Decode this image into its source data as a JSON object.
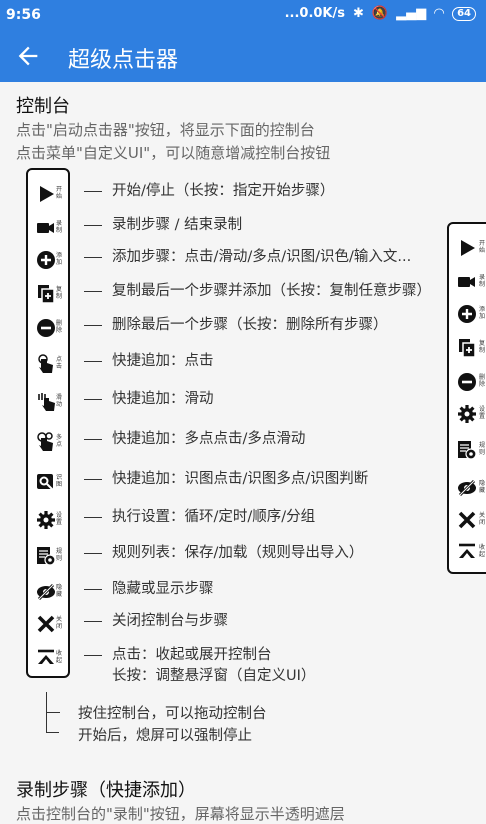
{
  "status_bar": {
    "time": "9:56",
    "network_speed": "...0.0K/s",
    "battery": "64"
  },
  "app_bar": {
    "title": "超级点击器"
  },
  "section1": {
    "heading": "控制台",
    "desc1": "点击\"启动点击器\"按钮，将显示下面的控制台",
    "desc2": "点击菜单\"自定义UI\"，可以随意增减控制台按钮"
  },
  "panel_buttons": [
    {
      "icon": "play-icon",
      "mini": "开始",
      "desc": "开始/停止（长按：指定开始步骤）"
    },
    {
      "icon": "record-icon",
      "mini": "录制",
      "desc": "录制步骤 / 结束录制"
    },
    {
      "icon": "add-icon",
      "mini": "添加",
      "desc": "添加步骤：点击/滑动/多点/识图/识色/输入文..."
    },
    {
      "icon": "copy-icon",
      "mini": "复制",
      "desc": "复制最后一个步骤并添加（长按：复制任意步骤）"
    },
    {
      "icon": "delete-icon",
      "mini": "删除",
      "desc": "删除最后一个步骤（长按：删除所有步骤）"
    },
    {
      "icon": "tap-icon",
      "mini": "点击",
      "desc": "快捷追加：点击"
    },
    {
      "icon": "swipe-icon",
      "mini": "滑动",
      "desc": "快捷追加：滑动"
    },
    {
      "icon": "multitouch-icon",
      "mini": "多点",
      "desc": "快捷追加：多点点击/多点滑动"
    },
    {
      "icon": "image-recognition-icon",
      "mini": "识图",
      "desc": "快捷追加：识图点击/识图多点/识图判断"
    },
    {
      "icon": "gear-icon",
      "mini": "设置",
      "desc": "执行设置：循环/定时/顺序/分组"
    },
    {
      "icon": "rules-icon",
      "mini": "规则",
      "desc": "规则列表：保存/加载（规则导出导入）"
    },
    {
      "icon": "hide-icon",
      "mini": "隐藏",
      "desc": "隐藏或显示步骤"
    },
    {
      "icon": "close-icon",
      "mini": "关闭",
      "desc": "关闭控制台与步骤"
    },
    {
      "icon": "collapse-icon",
      "mini": "收起",
      "desc": "点击：收起或展开控制台",
      "desc2": "长按：调整悬浮窗（自定义UI）"
    }
  ],
  "panel2_buttons": [
    {
      "icon": "play-icon",
      "mini": "开始"
    },
    {
      "icon": "record-icon",
      "mini": "录制"
    },
    {
      "icon": "add-icon",
      "mini": "添加"
    },
    {
      "icon": "copy-icon",
      "mini": "复制"
    },
    {
      "icon": "delete-icon",
      "mini": "删除"
    },
    {
      "icon": "gear-icon",
      "mini": "设置"
    },
    {
      "icon": "rules-icon",
      "mini": "规则"
    },
    {
      "icon": "hide-icon",
      "mini": "隐藏"
    },
    {
      "icon": "close-icon",
      "mini": "关闭"
    },
    {
      "icon": "collapse-icon",
      "mini": "收起"
    }
  ],
  "notes": {
    "drag": "按住控制台，可以拖动控制台",
    "force_stop": "开始后，熄屏可以强制停止"
  },
  "section2": {
    "heading": "录制步骤（快捷添加）",
    "desc1": "点击控制台的\"录制\"按钮，屏幕将显示半透明遮层"
  },
  "colors": {
    "primary": "#2f7fe0",
    "background": "#f5f5f5"
  }
}
